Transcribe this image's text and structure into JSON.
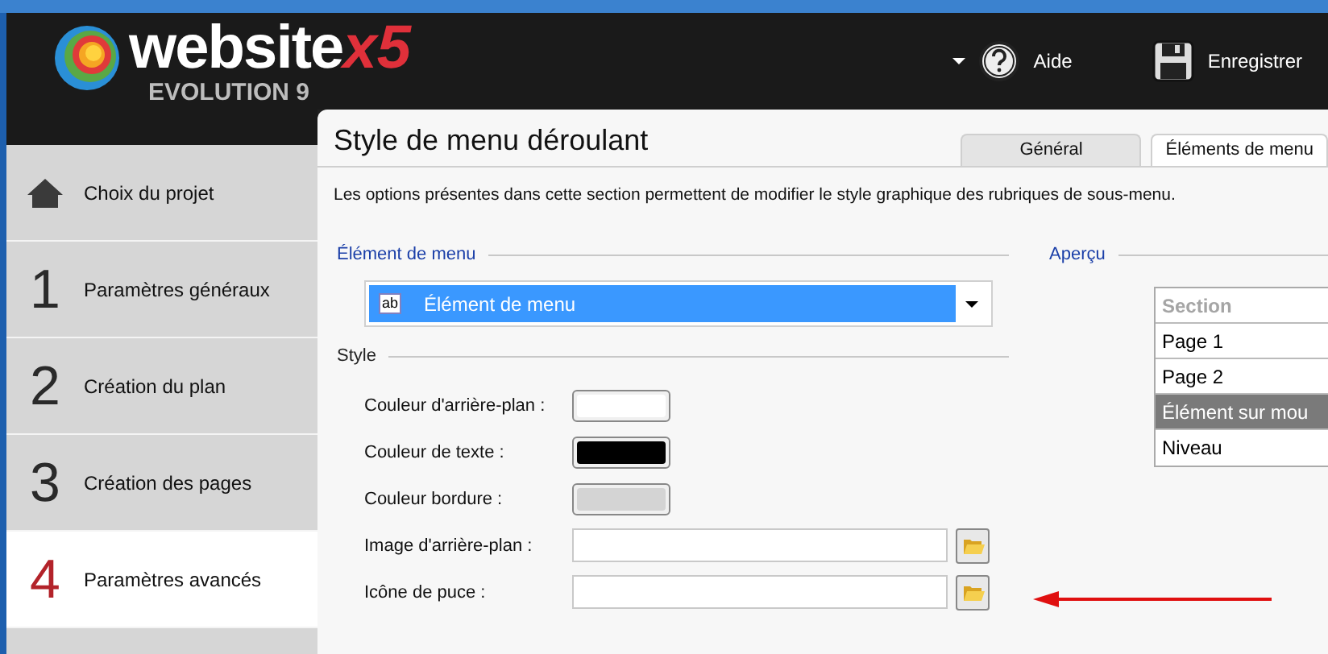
{
  "header": {
    "logo": {
      "word": "website",
      "mark": "x5",
      "edition": "EVOLUTION 9"
    },
    "actions": [
      {
        "kind": "help",
        "label": "Aide"
      },
      {
        "kind": "save",
        "label": "Enregistrer"
      }
    ]
  },
  "sidebar": {
    "items": [
      {
        "kind": "home",
        "label": "Choix du projet",
        "selected": false
      },
      {
        "kind": "step",
        "number": "1",
        "label": "Paramètres généraux",
        "selected": false
      },
      {
        "kind": "step",
        "number": "2",
        "label": "Création du plan",
        "selected": false
      },
      {
        "kind": "step",
        "number": "3",
        "label": "Création des pages",
        "selected": false
      },
      {
        "kind": "step",
        "number": "4",
        "label": "Paramètres avancés",
        "selected": true
      },
      {
        "kind": "partial",
        "selected": false
      }
    ]
  },
  "panel": {
    "title": "Style de menu déroulant",
    "tabs": [
      {
        "label": "Général",
        "selected": false
      },
      {
        "label": "Éléments de menu",
        "selected": true
      }
    ],
    "description": "Les options présentes dans cette section permettent de modifier le style graphique des rubriques de sous-menu.",
    "menu_element": {
      "legend": "Élément de menu",
      "dropdown": {
        "icon_text": "ab",
        "value": "Élément de menu"
      }
    },
    "style": {
      "legend": "Style",
      "fields": [
        {
          "kind": "color",
          "label": "Couleur d'arrière-plan :",
          "color": "#ffffff"
        },
        {
          "kind": "color",
          "label": "Couleur de texte :",
          "color": "#000000"
        },
        {
          "kind": "color",
          "label": "Couleur bordure :",
          "color": "#d4d4d4"
        },
        {
          "kind": "file",
          "label": "Image d'arrière-plan :"
        },
        {
          "kind": "file",
          "label": "Icône de puce :"
        }
      ]
    },
    "preview": {
      "legend": "Aperçu",
      "rows": [
        {
          "kind": "header",
          "label": "Section"
        },
        {
          "kind": "normal",
          "label": "Page 1"
        },
        {
          "kind": "normal",
          "label": "Page 2"
        },
        {
          "kind": "hover",
          "label": "Élément sur mou"
        },
        {
          "kind": "normal",
          "label": "Niveau"
        }
      ]
    }
  }
}
